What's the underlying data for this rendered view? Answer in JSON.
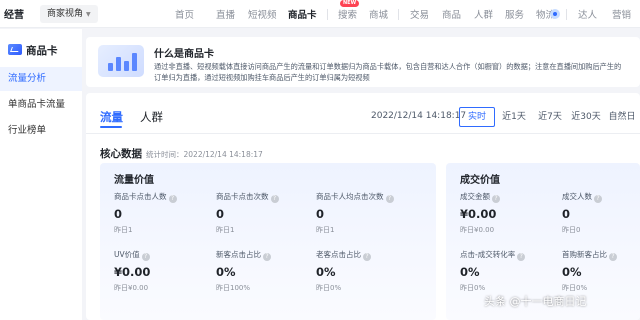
{
  "topbar": {
    "brand": "经营",
    "merchant_view": "商家视角",
    "nav_items": [
      "首页",
      "直播",
      "短视频",
      "商品卡",
      "搜索",
      "商城",
      "交易",
      "商品",
      "人群",
      "服务",
      "物流",
      "达人",
      "营销"
    ],
    "active_nav": "商品卡",
    "new_badge": "NEW"
  },
  "sidebar": {
    "heading": "商品卡",
    "items": [
      "流量分析",
      "单商品卡流量",
      "行业榜单"
    ],
    "active_item": "流量分析"
  },
  "banner": {
    "title": "什么是商品卡",
    "text": "通过非直播、短视频载体直接访问商品产生的流量和订单数据归为商品卡载体，包含自营和达人合作（如橱窗）的数据；注意在直播间加购后产生的订单归为直播，通过短视频加购挂车商品后产生的订单归属为短视频"
  },
  "panel": {
    "tabs": [
      "流量",
      "人群"
    ],
    "active_tab": "流量",
    "date": "2022/12/14 14:18:17",
    "ranges": [
      "实时",
      "近1天",
      "近7天",
      "近30天",
      "自然日"
    ],
    "active_range": "实时",
    "core_title": "核心数据",
    "core_time": "统计时间：2022/12/14 14:18:17"
  },
  "traffic_card": {
    "title": "流量价值",
    "metrics": [
      {
        "label": "商品卡点击人数",
        "value": "0",
        "prev": "昨日1"
      },
      {
        "label": "商品卡点击次数",
        "value": "0",
        "prev": "昨日1"
      },
      {
        "label": "商品卡人均点击次数",
        "value": "0",
        "prev": "昨日1"
      },
      {
        "label": "UV价值",
        "value": "¥0.00",
        "prev": "昨日¥0.00"
      },
      {
        "label": "新客点击占比",
        "value": "0%",
        "prev": "昨日100%"
      },
      {
        "label": "老客点击占比",
        "value": "0%",
        "prev": "昨日0%"
      }
    ]
  },
  "deal_card": {
    "title": "成交价值",
    "metrics": [
      {
        "label": "成交金额",
        "value": "¥0.00",
        "prev": "昨日¥0.00"
      },
      {
        "label": "成交人数",
        "value": "0",
        "prev": "昨日0"
      },
      {
        "label": "点击-成交转化率",
        "value": "0%",
        "prev": "昨日0%"
      },
      {
        "label": "首购新客占比",
        "value": "0%",
        "prev": "昨日0%"
      }
    ]
  },
  "watermark": "头条 @十一电商日记",
  "help_icon_glyph": "?",
  "colors": {
    "accent": "#2f6bff",
    "badge": "#fe4353"
  }
}
